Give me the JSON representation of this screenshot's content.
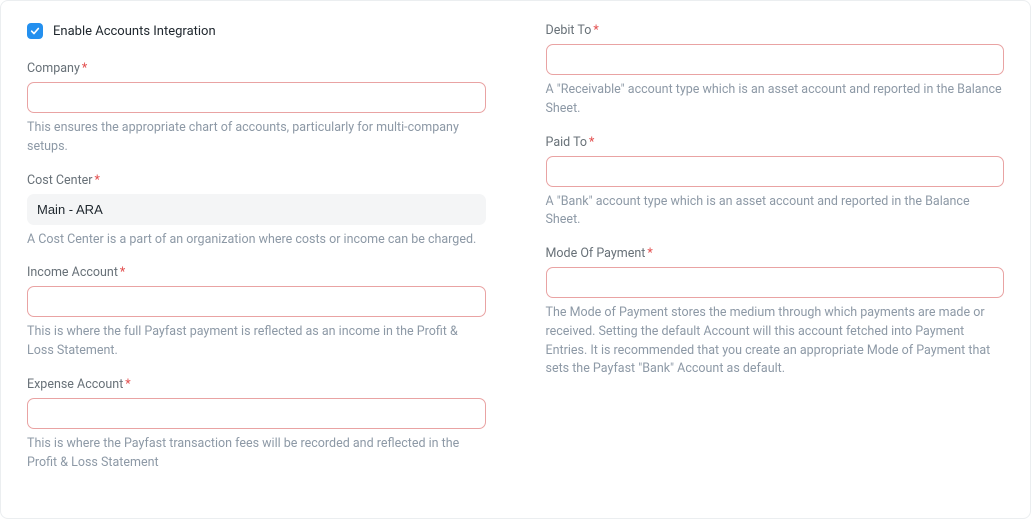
{
  "left": {
    "enable_label": "Enable Accounts Integration",
    "enable_checked": true,
    "company": {
      "label": "Company",
      "required_mark": "*",
      "value": "",
      "help": "This ensures the appropriate chart of accounts, particularly for multi-company setups."
    },
    "cost_center": {
      "label": "Cost Center",
      "required_mark": "*",
      "value": "Main - ARA",
      "help": "A Cost Center is a part of an organization where costs or income can be charged."
    },
    "income_account": {
      "label": "Income Account",
      "required_mark": "*",
      "value": "",
      "help": "This is where the full Payfast payment is reflected as an income in the Profit & Loss Statement."
    },
    "expense_account": {
      "label": "Expense Account",
      "required_mark": "*",
      "value": "",
      "help": "This is where the Payfast transaction fees will be recorded and reflected in the Profit & Loss Statement"
    }
  },
  "right": {
    "debit_to": {
      "label": "Debit To",
      "required_mark": "*",
      "value": "",
      "help": "A \"Receivable\" account type which is an asset account and reported in the Balance Sheet."
    },
    "paid_to": {
      "label": "Paid To",
      "required_mark": "*",
      "value": "",
      "help": "A \"Bank\" account type which is an asset account and reported in the Balance Sheet."
    },
    "mode_of_payment": {
      "label": "Mode Of Payment",
      "required_mark": "*",
      "value": "",
      "help": "The Mode of Payment stores the medium through which payments are made or received. Setting the default Account will this account fetched into Payment Entries. It is recommended that you create an appropriate Mode of Payment that sets the Payfast \"Bank\" Account as default."
    }
  }
}
